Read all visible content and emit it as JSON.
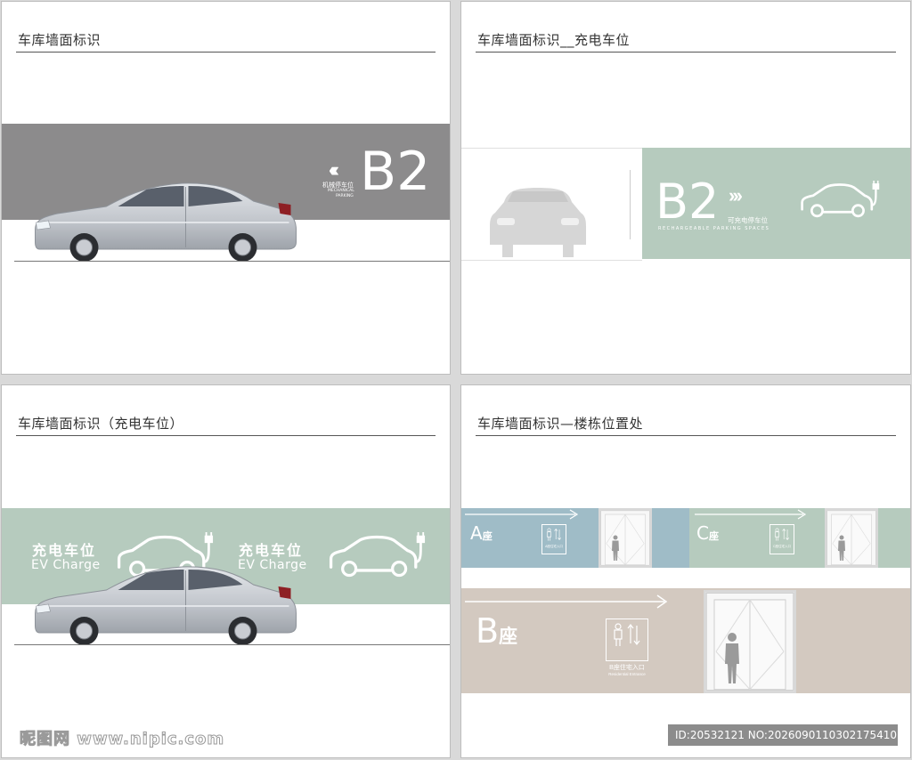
{
  "panels": {
    "p1": {
      "title": "车库墙面标识",
      "chevrons": "‹‹‹",
      "level": "B2",
      "label_cn": "机械停车位",
      "label_en_1": "MECHANICAL",
      "label_en_2": "PARKING"
    },
    "p2": {
      "title": "车库墙面标识__充电车位",
      "level": "B2",
      "chevrons": "›››",
      "label_cn": "可充电停车位",
      "label_en": "RECHARGEABLE PARKING SPACES"
    },
    "p3": {
      "title": "车库墙面标识（充电车位）",
      "label_cn_1": "充电车位",
      "label_en_1": "EV Charge",
      "label_cn_2": "充电车位",
      "label_en_2": "EV Charge"
    },
    "p4": {
      "title": "车库墙面标识—楼栋位置处",
      "zone_a_letter": "A",
      "zone_a_suffix": "座",
      "zone_c_letter": "C",
      "zone_c_suffix": "座",
      "zone_b_letter": "B",
      "zone_b_suffix": "座",
      "a_sign": "A座住宅入口",
      "c_sign": "C座住宅入口",
      "b_sign_cn": "B座住宅入口",
      "b_sign_en": "Residential Entrance"
    }
  },
  "footer": {
    "watermark": "昵图网 www.nipic.com",
    "id_text": "ID:20532121 NO:20260901103021754107"
  },
  "colors": {
    "gray_band": "#8c8b8c",
    "green_band": "#b6cbbe",
    "blue_band": "#9fbcc7",
    "beige_band": "#d3c9c0",
    "car_body": "#c9ccd2"
  }
}
